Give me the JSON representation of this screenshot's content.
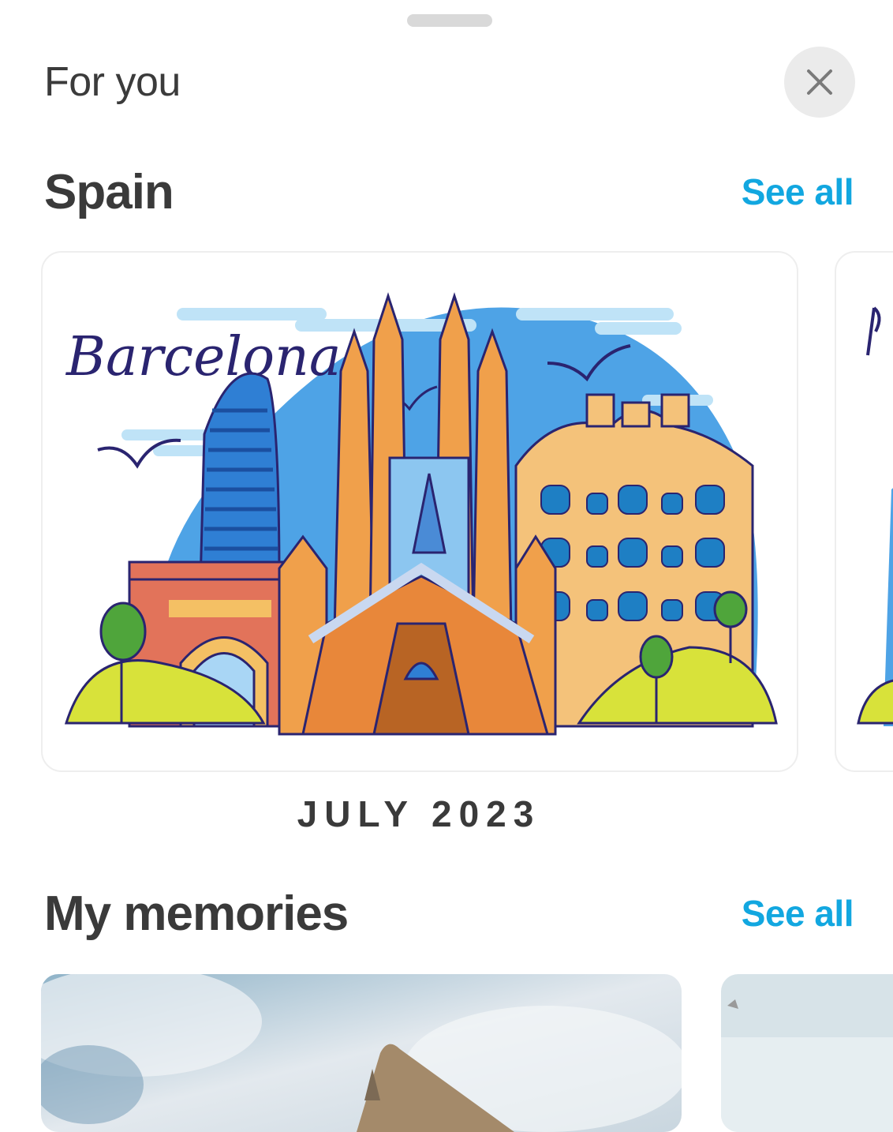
{
  "header": {
    "title": "For you"
  },
  "spain": {
    "title": "Spain",
    "see_all": "See all",
    "featured_card": {
      "illustration_text": "Barcelona",
      "caption": "JULY 2023"
    }
  },
  "memories": {
    "title": "My memories",
    "see_all": "See all"
  },
  "colors": {
    "accent": "#12a7e0",
    "text": "#3a3a3a",
    "close_bg": "#ebebeb"
  },
  "icons": {
    "close": "close-icon"
  }
}
